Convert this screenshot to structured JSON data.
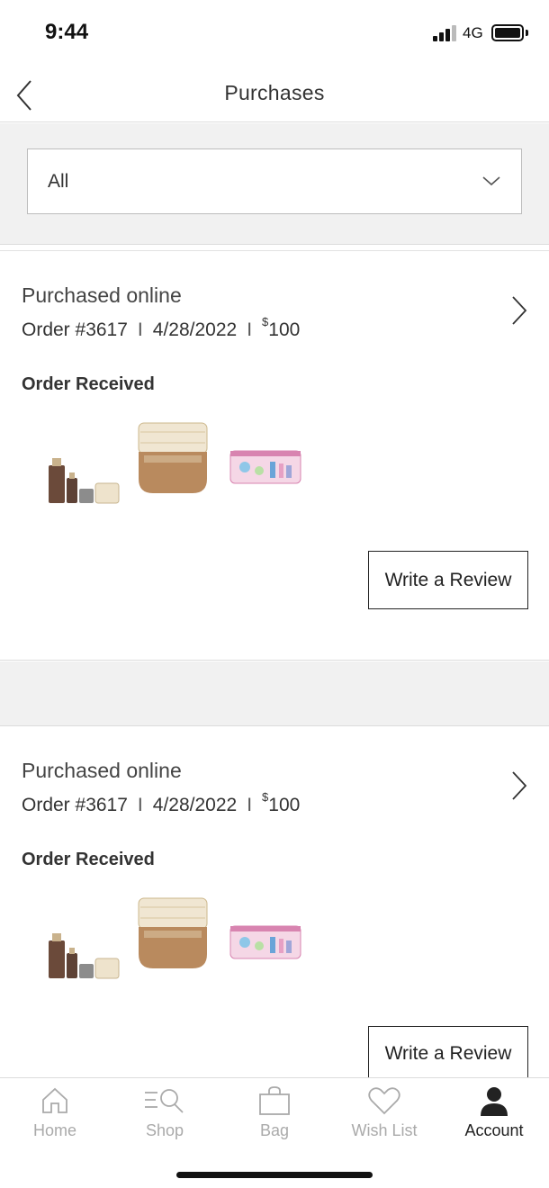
{
  "status_bar": {
    "time": "9:44",
    "network": "4G",
    "signal_bars_active": 3,
    "signal_bars_total": 4,
    "battery_level": 1.0
  },
  "header": {
    "title": "Purchases",
    "back_icon": "chevron-left-icon"
  },
  "filter": {
    "selected": "All",
    "icon": "chevron-down-icon"
  },
  "orders": [
    {
      "purchase_type": "Purchased online",
      "order_number": "Order #3617",
      "date": "4/28/2022",
      "price_currency": "$",
      "price_amount": "100",
      "status": "Order Received",
      "products": [
        "serum-set-image",
        "eye-cream-jar-image",
        "cosmetic-bag-image"
      ],
      "review_label": "Write a Review"
    },
    {
      "purchase_type": "Purchased online",
      "order_number": "Order #3617",
      "date": "4/28/2022",
      "price_currency": "$",
      "price_amount": "100",
      "status": "Order Received",
      "products": [
        "serum-set-image",
        "eye-cream-jar-image",
        "cosmetic-bag-image"
      ],
      "review_label": "Write a Review"
    }
  ],
  "tab_bar": {
    "tabs": [
      {
        "label": "Home",
        "icon": "home-icon"
      },
      {
        "label": "Shop",
        "icon": "search-list-icon"
      },
      {
        "label": "Bag",
        "icon": "bag-icon"
      },
      {
        "label": "Wish List",
        "icon": "heart-icon"
      },
      {
        "label": "Account",
        "icon": "person-icon"
      }
    ],
    "active": "Account"
  },
  "colors": {
    "background_band": "#f1f1f1",
    "border": "#dcdcdc",
    "text": "#333333",
    "inactive_tab": "#aaaaaa"
  }
}
